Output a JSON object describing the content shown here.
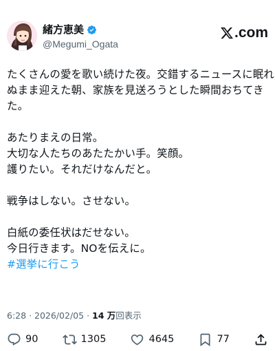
{
  "author": {
    "display_name": "緒方恵美",
    "handle": "@Megumi_Ogata"
  },
  "brand": {
    "logo_text": ".com"
  },
  "post": {
    "lines": [
      "たくさんの愛を歌い続けた夜。交錯するニュースに眠れ",
      "ぬまま迎えた朝、家族を見送ろうとした瞬間おちてき",
      "た。",
      "",
      "あたりまえの日常。",
      "大切な人たちのあたたかい手。笑顔。",
      "護りたい。それだけなんだと。",
      "",
      "戦争はしない。させない。",
      "",
      "白紙の委任状はだせない。",
      "今日行きます。NOを伝えに。"
    ],
    "hashtag": "#選挙に行こう"
  },
  "meta": {
    "time": "6:28",
    "separator": "·",
    "date": "2026/02/05",
    "views_count": "14 万",
    "views_label": "回表示"
  },
  "actions": {
    "replies": "90",
    "reposts": "1305",
    "likes": "4645",
    "bookmarks": "77"
  },
  "colors": {
    "accent": "#1d9bf0",
    "secondary_text": "#536471",
    "primary_text": "#0f1419"
  }
}
